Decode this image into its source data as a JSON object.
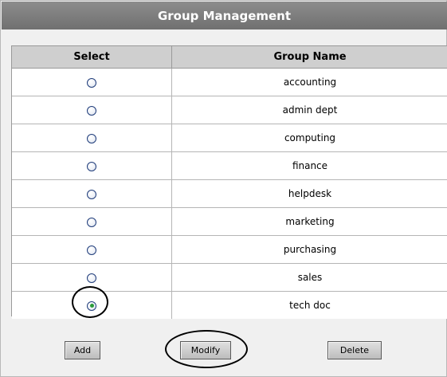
{
  "header": {
    "title": "Group Management"
  },
  "table": {
    "columns": [
      "Select",
      "Group Name"
    ],
    "rows": [
      {
        "name": "accounting",
        "selected": false
      },
      {
        "name": "admin dept",
        "selected": false
      },
      {
        "name": "computing",
        "selected": false
      },
      {
        "name": "finance",
        "selected": false
      },
      {
        "name": "helpdesk",
        "selected": false
      },
      {
        "name": "marketing",
        "selected": false
      },
      {
        "name": "purchasing",
        "selected": false
      },
      {
        "name": "sales",
        "selected": false
      },
      {
        "name": "tech doc",
        "selected": true
      }
    ]
  },
  "actions": {
    "add_label": "Add",
    "modify_label": "Modify",
    "delete_label": "Delete"
  },
  "colors": {
    "title_bar": "#7d7d7d",
    "header_row": "#cfcfcf",
    "radio_checked": "#2b9b3a"
  }
}
